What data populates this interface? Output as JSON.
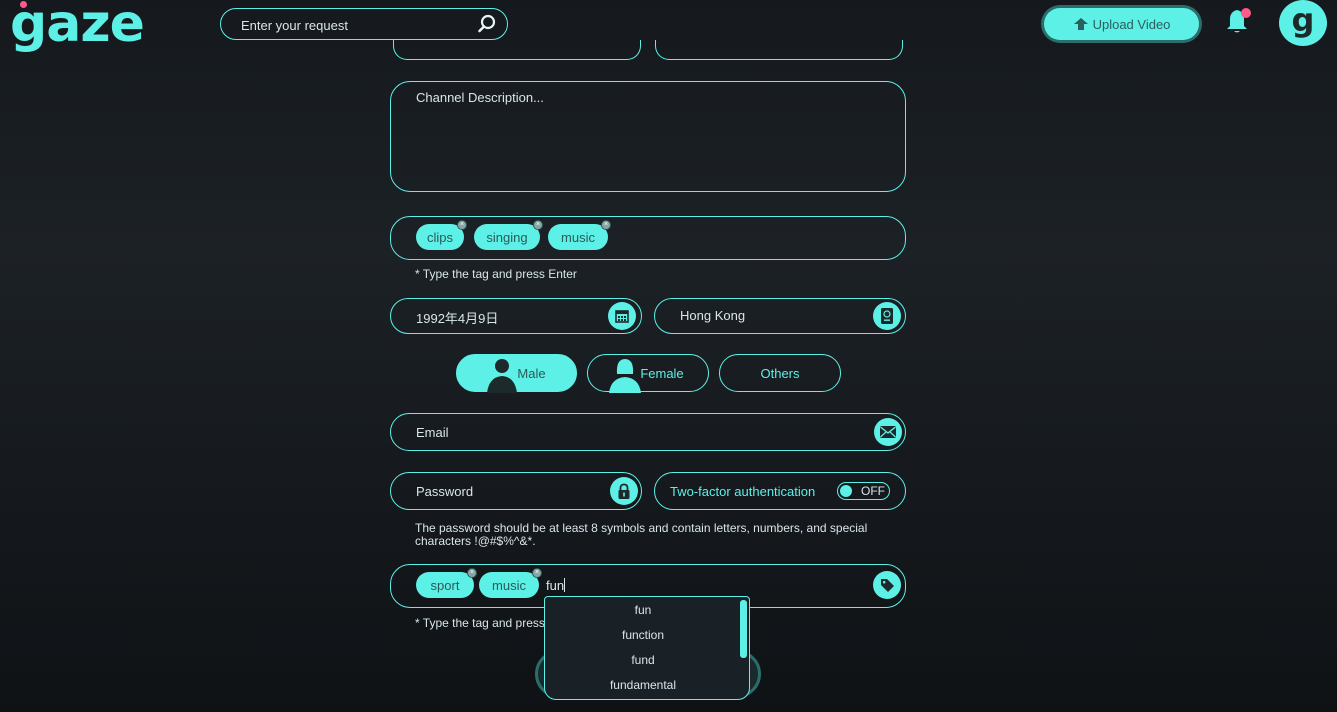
{
  "header": {
    "logo": "gaze",
    "search_placeholder": "Enter your request",
    "upload_label": "Upload Video"
  },
  "form": {
    "description_placeholder": "Channel Description...",
    "tags_top": [
      "clips",
      "singing",
      "music"
    ],
    "tag_hint": "* Type the tag and press Enter",
    "birthdate": "1992年4月9日",
    "location": "Hong Kong",
    "gender_options": [
      "Male",
      "Female",
      "Others"
    ],
    "selected_gender": "Male",
    "email_placeholder": "Email",
    "password_placeholder": "Password",
    "two_factor_label": "Two-factor authentication",
    "two_factor_state": "OFF",
    "password_hint_line1": "The password should be at least 8 symbols and contain letters, numbers, and special",
    "password_hint_line2": "characters !@#$%^&*.",
    "tags_bottom": [
      "sport",
      "music"
    ],
    "tag_input_value": "fun",
    "tag_hint_bottom": "* Type the tag and press Enter",
    "suggestions": [
      "fun",
      "function",
      "fund",
      "fundamental"
    ]
  },
  "colors": {
    "accent": "#5df0e6",
    "background": "#1c2126",
    "notification": "#ff5a8a"
  }
}
